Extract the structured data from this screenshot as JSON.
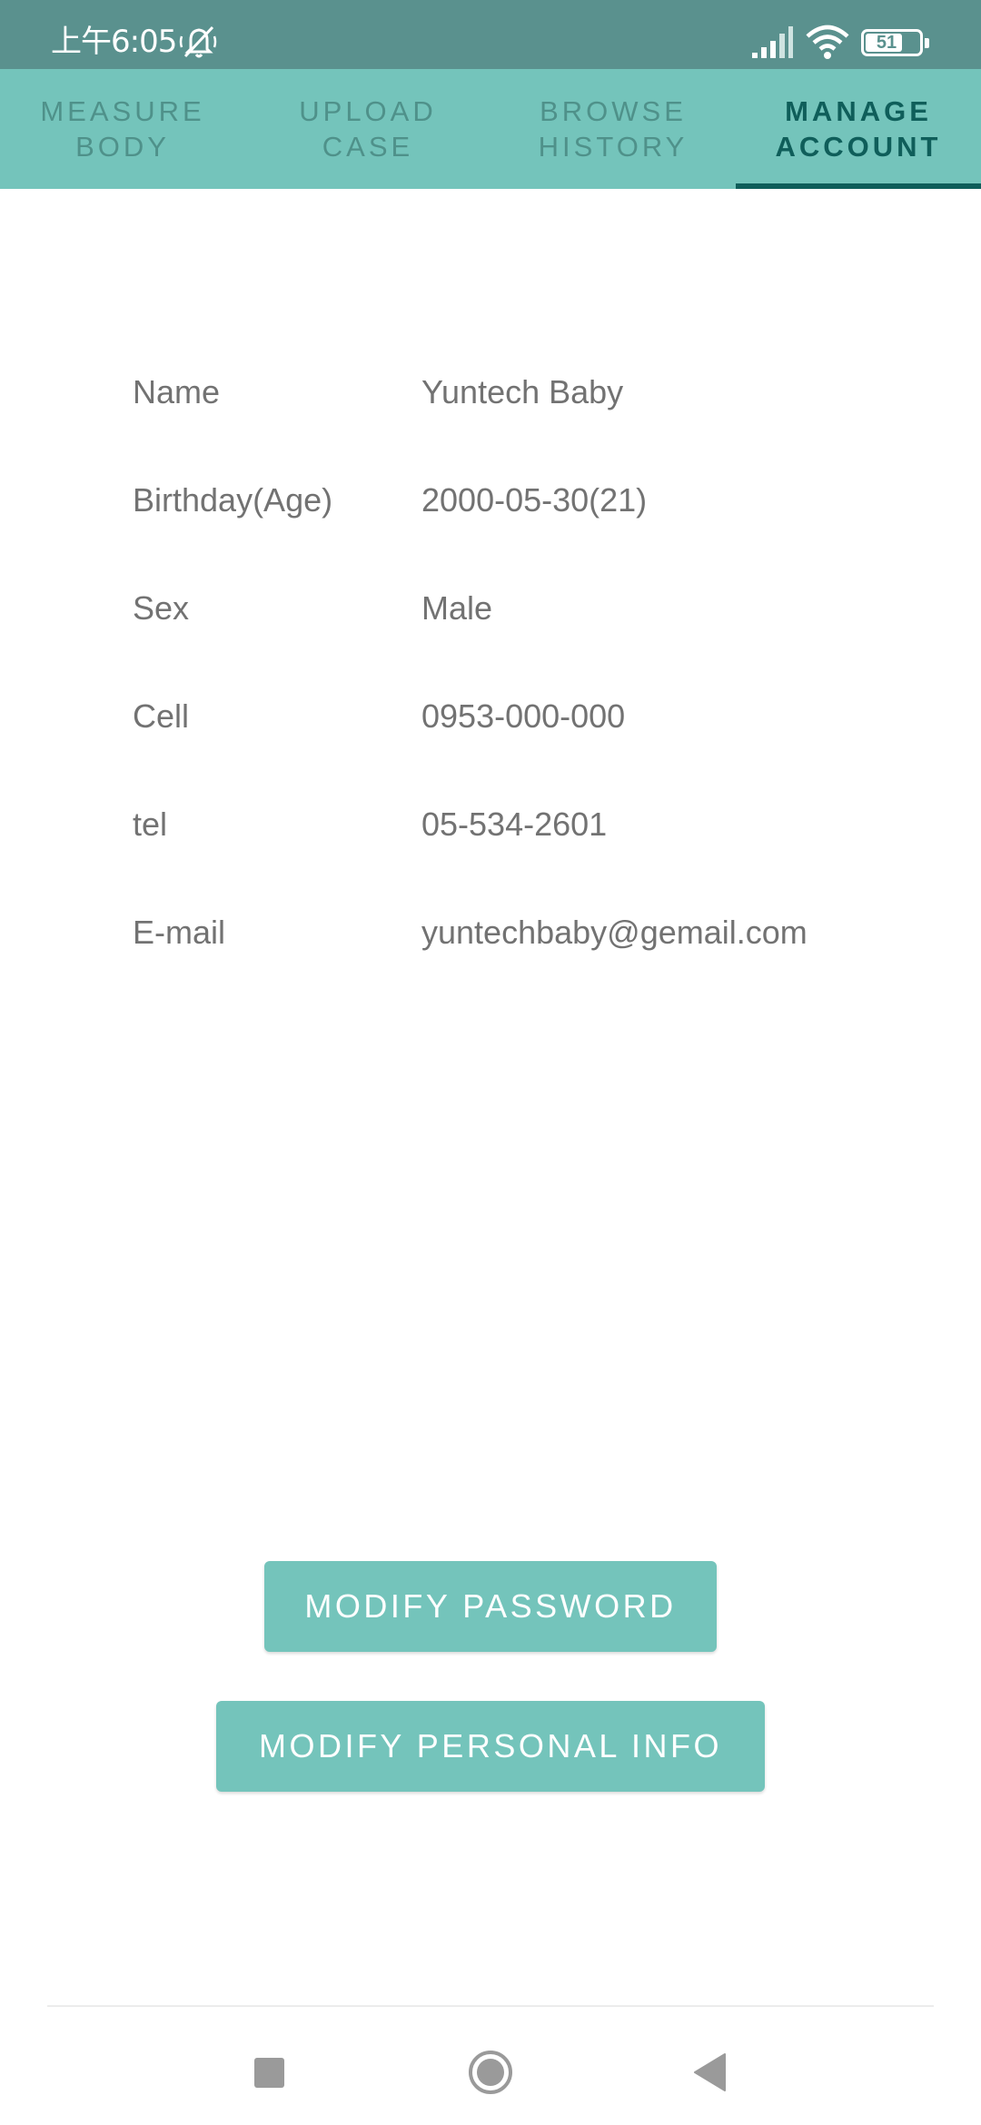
{
  "status_bar": {
    "time": "上午6:05",
    "battery": "51",
    "icons": [
      "mute-icon",
      "signal-icon",
      "wifi-icon",
      "battery-icon"
    ]
  },
  "tabs": [
    {
      "line1": "MEASURE",
      "line2": "BODY",
      "active": false
    },
    {
      "line1": "UPLOAD",
      "line2": "CASE",
      "active": false
    },
    {
      "line1": "BROWSE",
      "line2": "HISTORY",
      "active": false
    },
    {
      "line1": "MANAGE",
      "line2": "ACCOUNT",
      "active": true
    }
  ],
  "profile": [
    {
      "label": "Name",
      "value": "Yuntech Baby"
    },
    {
      "label": "Birthday(Age)",
      "value": "2000-05-30(21)"
    },
    {
      "label": "Sex",
      "value": "Male"
    },
    {
      "label": "Cell",
      "value": "0953-000-000"
    },
    {
      "label": "tel",
      "value": "05-534-2601"
    },
    {
      "label": "E-mail",
      "value": "yuntechbaby@gemail.com"
    }
  ],
  "buttons": {
    "modify_password": "MODIFY PASSWORD",
    "modify_personal_info": "MODIFY PERSONAL INFO"
  },
  "colors": {
    "status_bar": "#5a918e",
    "tab_bar": "#74c4bb",
    "tab_active": "#0f5e5a",
    "tab_inactive": "#4f918a",
    "button": "#74c4bb",
    "text": "#727272"
  }
}
